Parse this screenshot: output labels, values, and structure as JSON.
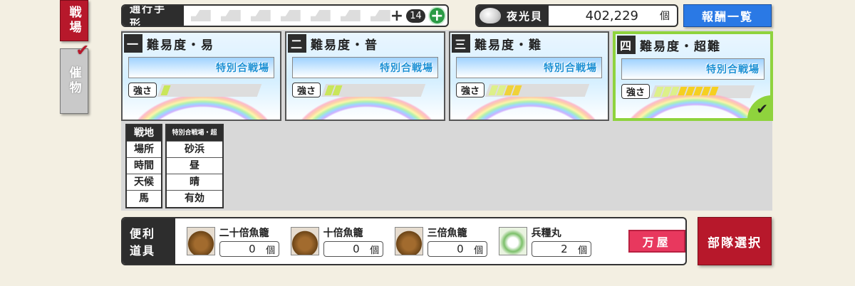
{
  "side_tabs": {
    "battlefield": "戦場",
    "event": "催物",
    "event_mark": "✔"
  },
  "pass": {
    "label": "通行手形",
    "plus": "+",
    "count": "14",
    "add_symbol": "+",
    "slots": 7
  },
  "shell": {
    "label": "夜光貝",
    "value": "402,229",
    "unit": "個"
  },
  "reward_button": "報酬一覧",
  "difficulties": [
    {
      "num": "一",
      "title": "難易度・易",
      "banner": "特別合戦場",
      "strength_label": "強さ",
      "level": 1,
      "selected": false
    },
    {
      "num": "二",
      "title": "難易度・普",
      "banner": "特別合戦場",
      "strength_label": "強さ",
      "level": 2,
      "selected": false
    },
    {
      "num": "三",
      "title": "難易度・難",
      "banner": "特別合戦場",
      "strength_label": "強さ",
      "level": 4,
      "selected": false
    },
    {
      "num": "四",
      "title": "難易度・超難",
      "banner": "特別合戦場",
      "strength_label": "強さ",
      "level": 8,
      "selected": true
    }
  ],
  "info": {
    "headers": [
      "戦地",
      "特別合戦場・超難"
    ],
    "rows": [
      {
        "key": "場所",
        "value": "砂浜"
      },
      {
        "key": "時間",
        "value": "昼"
      },
      {
        "key": "天候",
        "value": "晴"
      },
      {
        "key": "馬",
        "value": "有効"
      }
    ]
  },
  "items": {
    "label": "便利道具",
    "list": [
      {
        "name": "二十倍魚籠",
        "count": "0",
        "unit": "個",
        "icon": "basket-icon"
      },
      {
        "name": "十倍魚籠",
        "count": "0",
        "unit": "個",
        "icon": "basket-icon"
      },
      {
        "name": "三倍魚籠",
        "count": "0",
        "unit": "個",
        "icon": "basket-icon"
      },
      {
        "name": "兵糧丸",
        "count": "2",
        "unit": "個",
        "icon": "rice-ball-icon"
      }
    ],
    "shop_button": "万屋"
  },
  "deploy_button": "部隊選択",
  "colors": {
    "accent_red": "#b7182b",
    "selected_green": "#8fd33d",
    "reward_blue": "#2a79e5",
    "shop_pink": "#e8385e"
  }
}
